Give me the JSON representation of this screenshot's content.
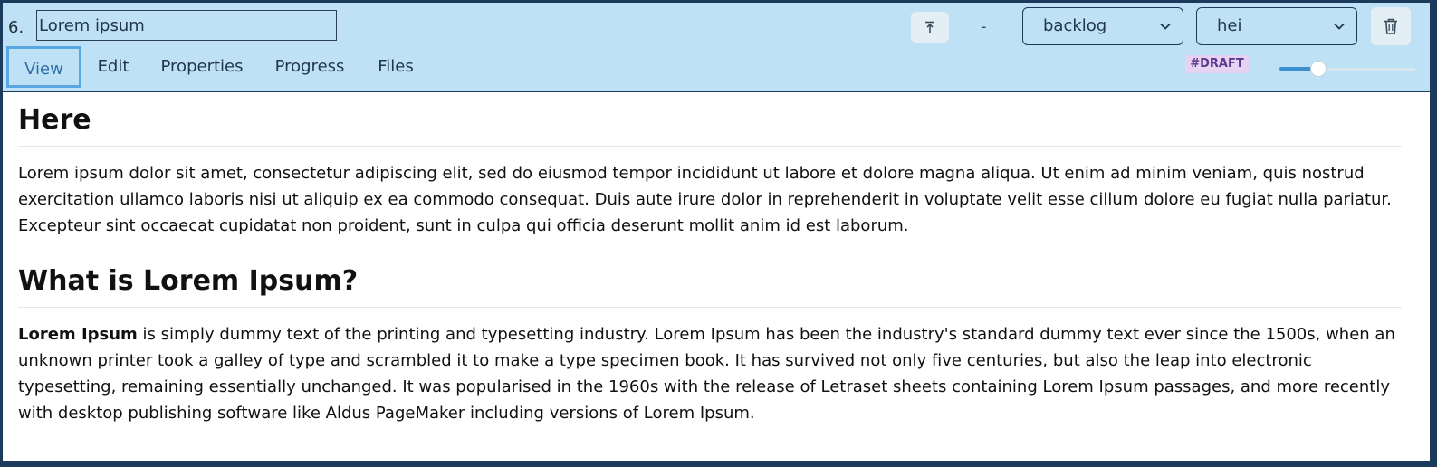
{
  "item": {
    "index": "6.",
    "title_value": "Lorem ipsum",
    "separator": "-",
    "status_value": "backlog",
    "assignee_value": "hei",
    "tag": "#DRAFT",
    "progress": 0.28
  },
  "tabs": [
    {
      "label": "View",
      "active": true
    },
    {
      "label": "Edit",
      "active": false
    },
    {
      "label": "Properties",
      "active": false
    },
    {
      "label": "Progress",
      "active": false
    },
    {
      "label": "Files",
      "active": false
    }
  ],
  "content": {
    "heading1": "Here",
    "paragraph1": "Lorem ipsum dolor sit amet, consectetur adipiscing elit, sed do eiusmod tempor incididunt ut labore et dolore magna aliqua. Ut enim ad minim veniam, quis nostrud exercitation ullamco laboris nisi ut aliquip ex ea commodo consequat. Duis aute irure dolor in reprehenderit in voluptate velit esse cillum dolore eu fugiat nulla pariatur. Excepteur sint occaecat cupidatat non proident, sunt in culpa qui officia deserunt mollit anim id est laborum.",
    "heading2": "What is Lorem Ipsum?",
    "paragraph2_bold": "Lorem Ipsum",
    "paragraph2_rest": " is simply dummy text of the printing and typesetting industry. Lorem Ipsum has been the industry's standard dummy text ever since the 1500s, when an unknown printer took a galley of type and scrambled it to make a type specimen book. It has survived not only five centuries, but also the leap into electronic typesetting, remaining essentially unchanged. It was popularised in the 1960s with the release of Letraset sheets containing Lorem Ipsum passages, and more recently with desktop publishing software like Aldus PageMaker including versions of Lorem Ipsum."
  },
  "icons": {
    "move_top": "move-to-top-icon",
    "trash": "trash-icon",
    "chevron": "chevron-down-icon"
  },
  "colors": {
    "header_bg": "#bfe1f6",
    "frame_border": "#1c3a5c",
    "active_tab": "#5aa6e0",
    "badge_bg": "#e6d2f3",
    "badge_text": "#5b3a8a",
    "slider_fill": "#3d8fd0"
  }
}
